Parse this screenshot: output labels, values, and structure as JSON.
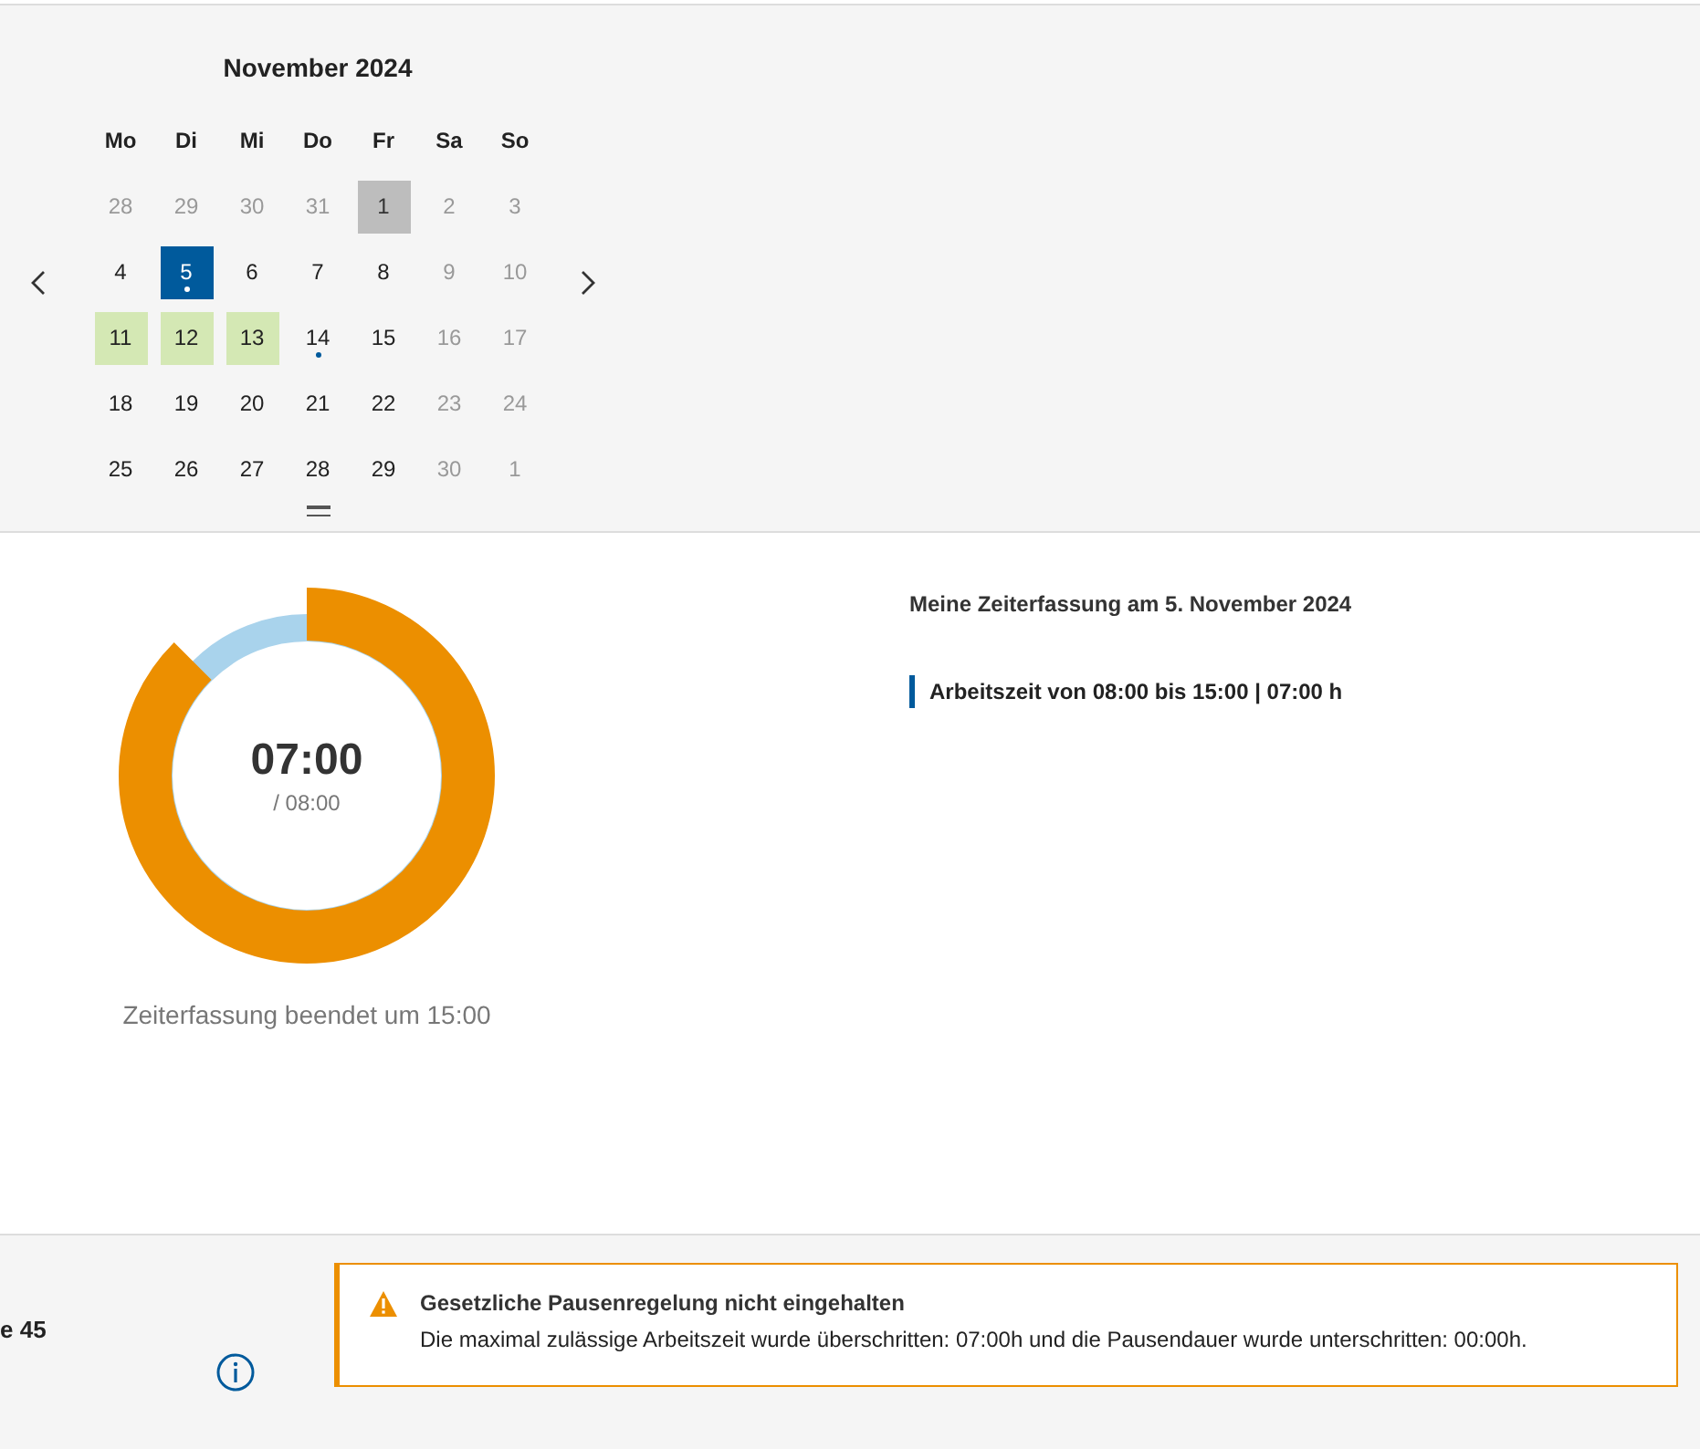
{
  "calendar": {
    "title": "November 2024",
    "weekdays": [
      "Mo",
      "Di",
      "Mi",
      "Do",
      "Fr",
      "Sa",
      "So"
    ],
    "days": [
      {
        "label": "28",
        "muted": true,
        "kind": "plain",
        "selected": false,
        "dot": false
      },
      {
        "label": "29",
        "muted": true,
        "kind": "plain",
        "selected": false,
        "dot": false
      },
      {
        "label": "30",
        "muted": true,
        "kind": "plain",
        "selected": false,
        "dot": false
      },
      {
        "label": "31",
        "muted": true,
        "kind": "plain",
        "selected": false,
        "dot": false
      },
      {
        "label": "1",
        "muted": false,
        "kind": "holiday",
        "selected": false,
        "dot": false
      },
      {
        "label": "2",
        "muted": true,
        "kind": "plain",
        "selected": false,
        "dot": false
      },
      {
        "label": "3",
        "muted": true,
        "kind": "plain",
        "selected": false,
        "dot": false
      },
      {
        "label": "4",
        "muted": false,
        "kind": "plain",
        "selected": false,
        "dot": false
      },
      {
        "label": "5",
        "muted": false,
        "kind": "plain",
        "selected": true,
        "dot": true
      },
      {
        "label": "6",
        "muted": false,
        "kind": "plain",
        "selected": false,
        "dot": false
      },
      {
        "label": "7",
        "muted": false,
        "kind": "plain",
        "selected": false,
        "dot": false
      },
      {
        "label": "8",
        "muted": false,
        "kind": "plain",
        "selected": false,
        "dot": false
      },
      {
        "label": "9",
        "muted": true,
        "kind": "plain",
        "selected": false,
        "dot": false
      },
      {
        "label": "10",
        "muted": true,
        "kind": "plain",
        "selected": false,
        "dot": false
      },
      {
        "label": "11",
        "muted": false,
        "kind": "absence",
        "selected": false,
        "dot": false
      },
      {
        "label": "12",
        "muted": false,
        "kind": "absence",
        "selected": false,
        "dot": false
      },
      {
        "label": "13",
        "muted": false,
        "kind": "absence",
        "selected": false,
        "dot": false
      },
      {
        "label": "14",
        "muted": false,
        "kind": "plain",
        "selected": false,
        "dot": true
      },
      {
        "label": "15",
        "muted": false,
        "kind": "plain",
        "selected": false,
        "dot": false
      },
      {
        "label": "16",
        "muted": true,
        "kind": "plain",
        "selected": false,
        "dot": false
      },
      {
        "label": "17",
        "muted": true,
        "kind": "plain",
        "selected": false,
        "dot": false
      },
      {
        "label": "18",
        "muted": false,
        "kind": "plain",
        "selected": false,
        "dot": false
      },
      {
        "label": "19",
        "muted": false,
        "kind": "plain",
        "selected": false,
        "dot": false
      },
      {
        "label": "20",
        "muted": false,
        "kind": "plain",
        "selected": false,
        "dot": false
      },
      {
        "label": "21",
        "muted": false,
        "kind": "plain",
        "selected": false,
        "dot": false
      },
      {
        "label": "22",
        "muted": false,
        "kind": "plain",
        "selected": false,
        "dot": false
      },
      {
        "label": "23",
        "muted": true,
        "kind": "plain",
        "selected": false,
        "dot": false
      },
      {
        "label": "24",
        "muted": true,
        "kind": "plain",
        "selected": false,
        "dot": false
      },
      {
        "label": "25",
        "muted": false,
        "kind": "plain",
        "selected": false,
        "dot": false
      },
      {
        "label": "26",
        "muted": false,
        "kind": "plain",
        "selected": false,
        "dot": false
      },
      {
        "label": "27",
        "muted": false,
        "kind": "plain",
        "selected": false,
        "dot": false
      },
      {
        "label": "28",
        "muted": false,
        "kind": "plain",
        "selected": false,
        "dot": false
      },
      {
        "label": "29",
        "muted": false,
        "kind": "plain",
        "selected": false,
        "dot": false
      },
      {
        "label": "30",
        "muted": true,
        "kind": "plain",
        "selected": false,
        "dot": false
      },
      {
        "label": "1",
        "muted": true,
        "kind": "plain",
        "selected": false,
        "dot": false
      }
    ]
  },
  "progress": {
    "time": "07:00",
    "target": "/ 08:00",
    "level": 0.875,
    "status": "Zeiterfassung beendet um 15:00"
  },
  "details": {
    "title": "Meine Zeiterfassung am 5. November 2024",
    "entries": [
      "Arbeitszeit von 08:00 bis 15:00 | 07:00 h"
    ]
  },
  "footer": {
    "label": "e 45",
    "alert": {
      "title": "Gesetzliche Pausenregelung nicht eingehalten",
      "message": "Die maximal zulässige Arbeitszeit wurde überschritten: 07:00h und die Pausendauer wurde unterschritten: 00:00h."
    }
  }
}
